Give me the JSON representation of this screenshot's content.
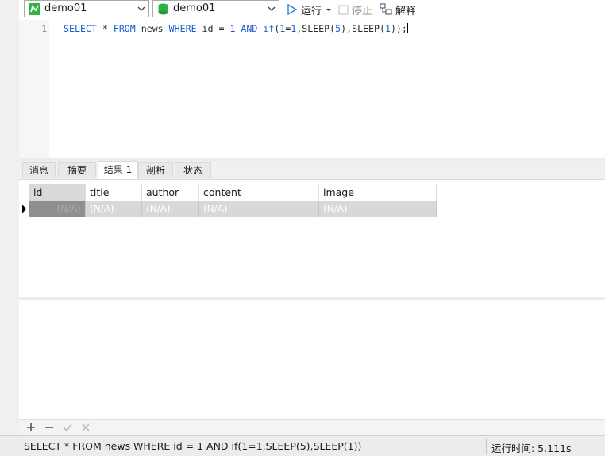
{
  "toolbar": {
    "connection": "demo01",
    "database": "demo01",
    "run_label": "运行",
    "stop_label": "停止",
    "explain_label": "解释"
  },
  "editor": {
    "line_number": "1",
    "query_tokens": {
      "select": "SELECT",
      "star": " * ",
      "from": "FROM",
      "table": " news ",
      "where": "WHERE",
      "cond": " id = ",
      "id_val": "1",
      "sp": " ",
      "and": "AND",
      "sp2": " ",
      "if": "if",
      "open": "(",
      "one_a": "1",
      "eq": "=",
      "one_b": "1",
      "sleep1": ",SLEEP(",
      "five": "5",
      "sleep2": "),SLEEP(",
      "one_c": "1",
      "close": "));"
    }
  },
  "tabs": [
    "消息",
    "摘要",
    "结果 1",
    "剖析",
    "状态"
  ],
  "active_tab": "结果 1",
  "grid": {
    "columns": [
      "id",
      "title",
      "author",
      "content",
      "image"
    ],
    "rows": [
      [
        "(N/A)",
        "(N/A)",
        "(N/A)",
        "(N/A)",
        "(N/A)"
      ]
    ]
  },
  "status": {
    "sql": "SELECT * FROM news WHERE id = 1 AND if(1=1,SLEEP(5),SLEEP(1))",
    "time": "运行时间: 5.111s"
  },
  "colors": {
    "keyword": "#1c5bd4",
    "selected_cell": "#8f8f8f",
    "row_bg": "#d8d8d8"
  },
  "icons": {
    "connection": "mysql-connection-icon",
    "database": "database-icon",
    "run": "play-icon",
    "stop": "stop-icon",
    "explain": "explain-icon"
  }
}
